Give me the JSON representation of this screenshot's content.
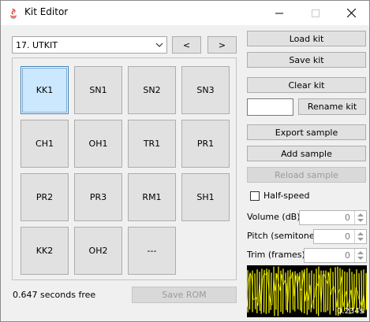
{
  "window": {
    "title": "Kit Editor"
  },
  "kit_select": {
    "value": "17. UTKIT"
  },
  "nav": {
    "prev_label": "<",
    "next_label": ">"
  },
  "pads": [
    {
      "label": "KK1",
      "selected": true
    },
    {
      "label": "SN1"
    },
    {
      "label": "SN2"
    },
    {
      "label": "SN3"
    },
    {
      "label": "CH1"
    },
    {
      "label": "OH1"
    },
    {
      "label": "TR1"
    },
    {
      "label": "PR1"
    },
    {
      "label": "PR2"
    },
    {
      "label": "PR3"
    },
    {
      "label": "RM1"
    },
    {
      "label": "SH1"
    },
    {
      "label": "KK2"
    },
    {
      "label": "OH2"
    },
    {
      "label": "---"
    }
  ],
  "status": {
    "free_text": "0.647 seconds free"
  },
  "buttons": {
    "save_rom": "Save ROM",
    "load_kit": "Load kit",
    "save_kit": "Save kit",
    "clear_kit": "Clear kit",
    "rename_kit": "Rename kit",
    "export_sample": "Export sample",
    "add_sample": "Add sample",
    "reload_sample": "Reload sample"
  },
  "rename_input": {
    "value": ""
  },
  "half_speed": {
    "label": "Half-speed",
    "checked": false
  },
  "volume": {
    "label": "Volume (dB):",
    "value": "0"
  },
  "pitch": {
    "label": "Pitch (semitone):",
    "value": "0"
  },
  "trim": {
    "label": "Trim (frames):",
    "value": "0"
  },
  "waveform": {
    "duration_label": "0.234s",
    "color": "#ffff00"
  }
}
